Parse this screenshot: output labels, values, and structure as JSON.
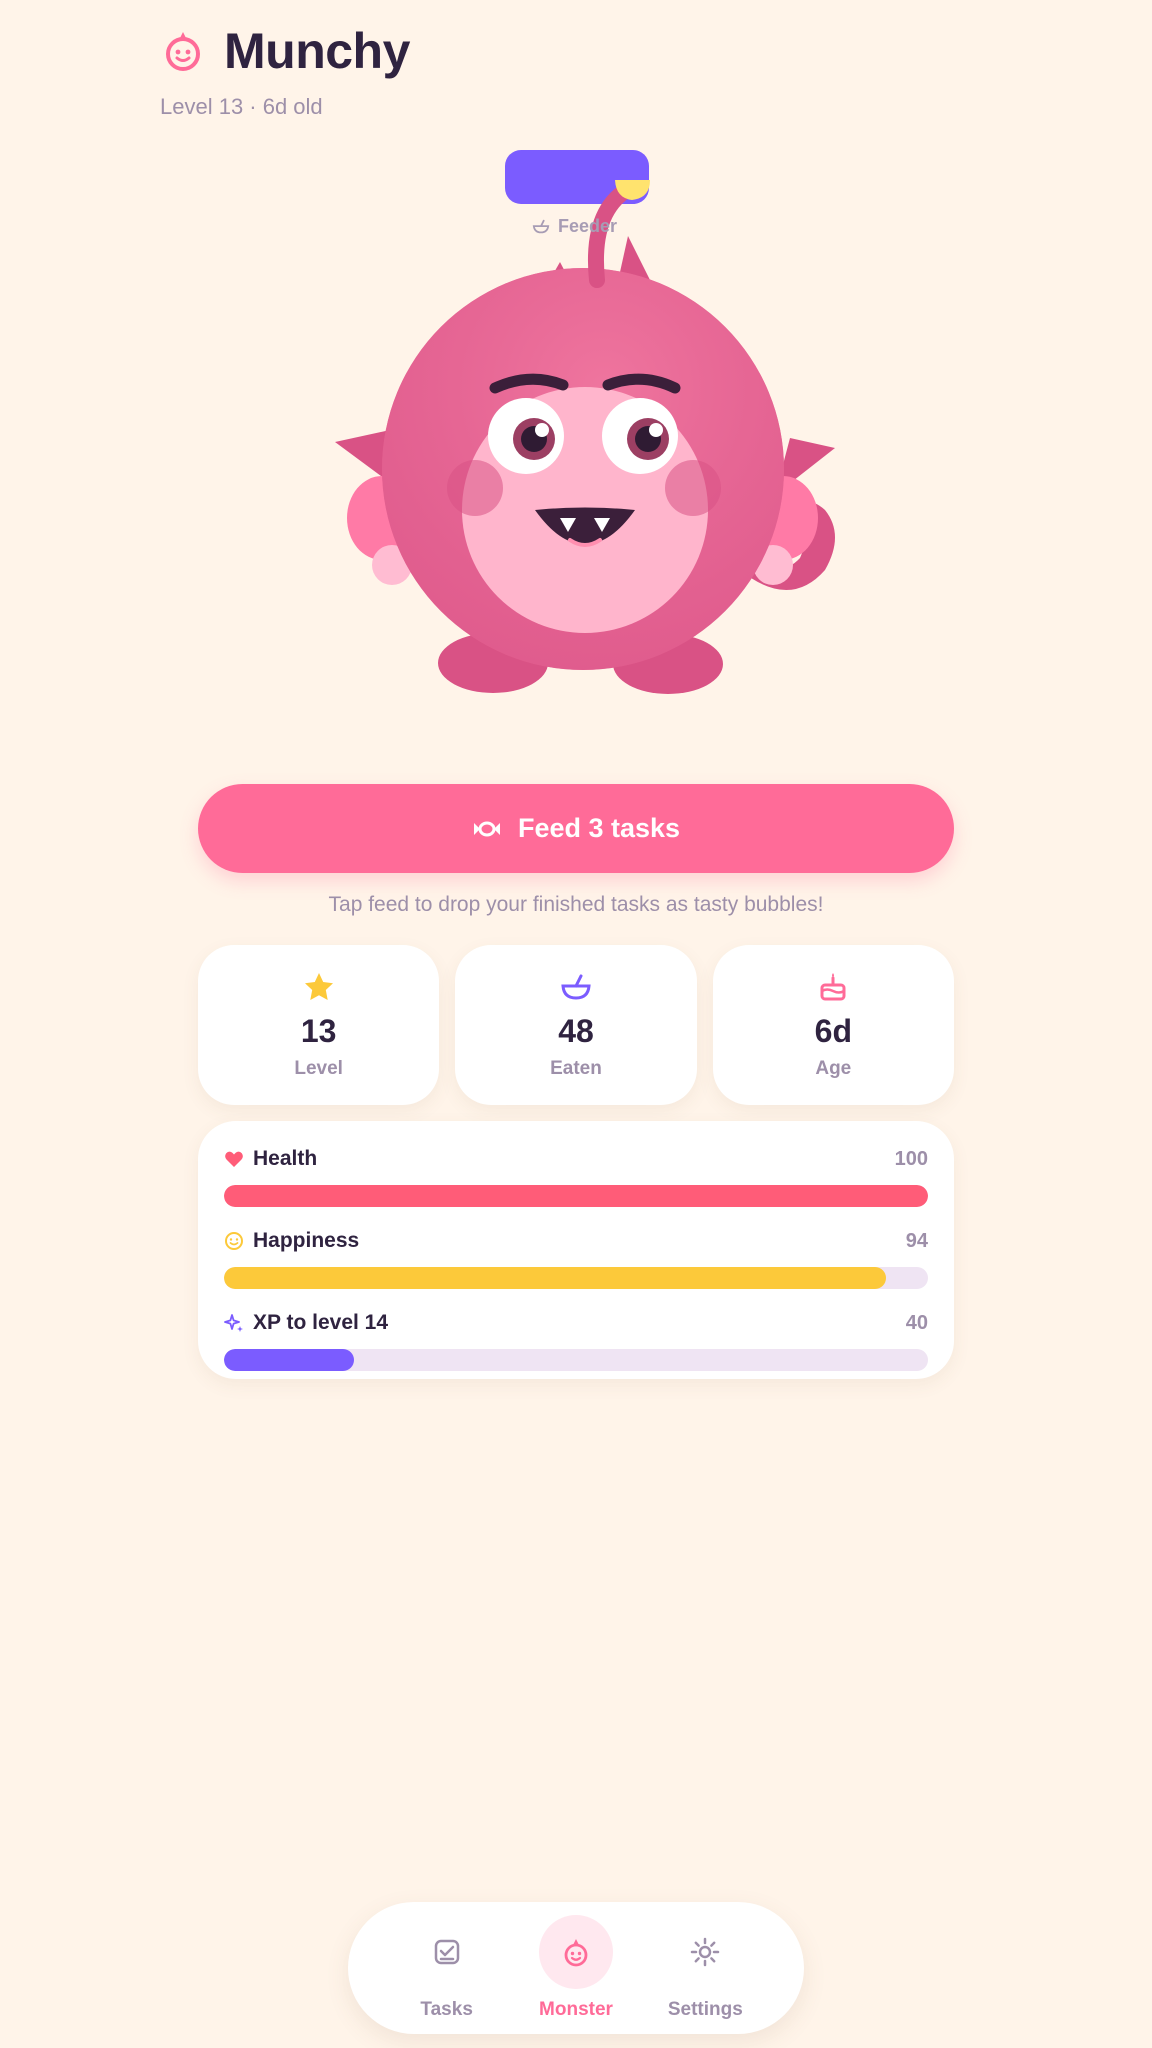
{
  "colors": {
    "background": "#fff4e9",
    "accent_pink": "#ff6b98",
    "health": "#ff5c78",
    "happiness": "#fcc93a",
    "xp": "#7b5cff",
    "track": "#efe4f3",
    "text_dark": "#2f2340",
    "text_muted": "#9d8fa9"
  },
  "header": {
    "icon": "monster-face-icon",
    "title": "Munchy",
    "subtitle": "Level 13 · 6d old"
  },
  "stage": {
    "feeder_icon": "bowl-icon",
    "feeder_label": "Feeder",
    "monster": "pink-monster-illustration"
  },
  "feed": {
    "icon": "candy-icon",
    "label": "Feed 3 tasks",
    "hint": "Tap feed to drop your finished tasks as tasty bubbles!"
  },
  "stats": [
    {
      "icon": "star-icon",
      "value": "13",
      "label": "Level"
    },
    {
      "icon": "bowl-icon",
      "value": "48",
      "label": "Eaten"
    },
    {
      "icon": "cake-icon",
      "value": "6d",
      "label": "Age"
    }
  ],
  "bars": [
    {
      "icon": "heart-icon",
      "label": "Health",
      "value": "100",
      "fraction": 1.0
    },
    {
      "icon": "smile-icon",
      "label": "Happiness",
      "value": "94",
      "fraction": 0.94
    },
    {
      "icon": "sparkle-icon",
      "label": "XP to level 14",
      "value": "40",
      "fraction": 0.185
    }
  ],
  "nav": {
    "items": [
      {
        "icon": "tasks-checkbox-icon",
        "label": "Tasks",
        "active": false
      },
      {
        "icon": "monster-face-icon",
        "label": "Monster",
        "active": true
      },
      {
        "icon": "settings-gear-icon",
        "label": "Settings",
        "active": false
      }
    ]
  }
}
